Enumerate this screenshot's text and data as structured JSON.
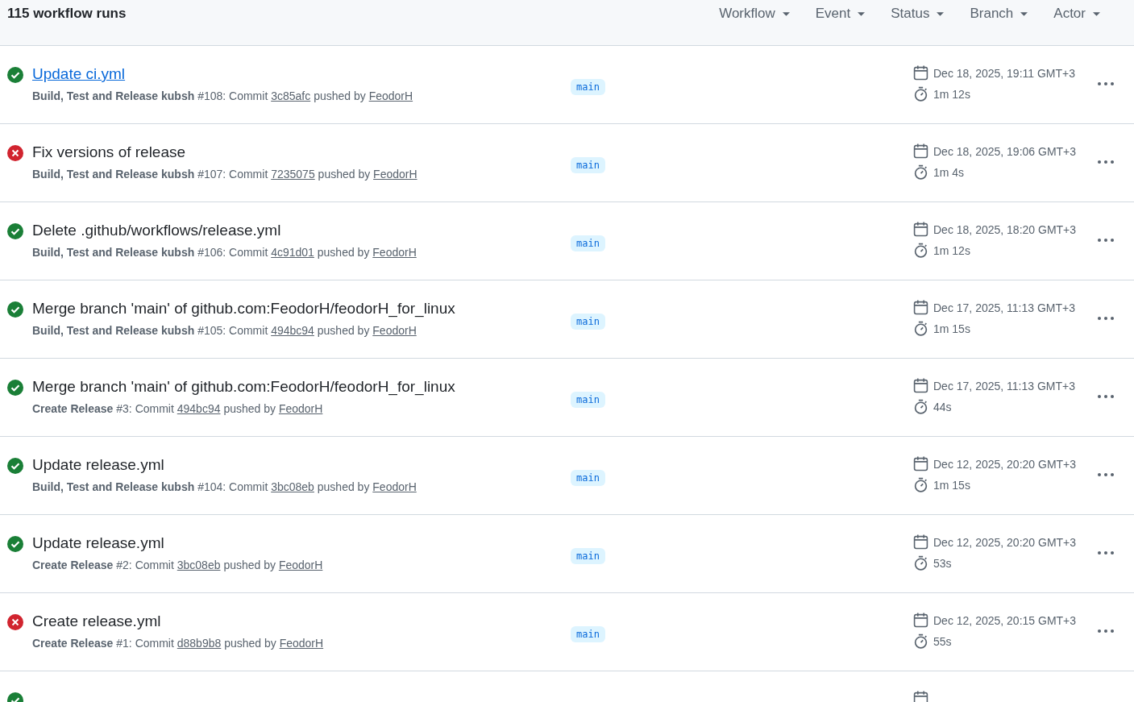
{
  "header": {
    "count": "115 workflow runs",
    "filters": [
      "Workflow",
      "Event",
      "Status",
      "Branch",
      "Actor"
    ]
  },
  "runs": [
    {
      "kind": "success",
      "title": "Update ci.yml",
      "hovered": true,
      "workflow": "Build, Test and Release kubsh",
      "detail": "#108: Commit",
      "commit": "3c85afc",
      "pushed_by": "pushed by",
      "actor": "FeodorH",
      "branch": "main",
      "date": "Dec 18, 2025, 19:11 GMT+3",
      "duration": "1m 12s"
    },
    {
      "kind": "failure",
      "title": "Fix versions of release",
      "hovered": false,
      "workflow": "Build, Test and Release kubsh",
      "detail": "#107: Commit",
      "commit": "7235075",
      "pushed_by": "pushed by",
      "actor": "FeodorH",
      "branch": "main",
      "date": "Dec 18, 2025, 19:06 GMT+3",
      "duration": "1m 4s"
    },
    {
      "kind": "success",
      "title": "Delete .github/workflows/release.yml",
      "hovered": false,
      "workflow": "Build, Test and Release kubsh",
      "detail": "#106: Commit",
      "commit": "4c91d01",
      "pushed_by": "pushed by",
      "actor": "FeodorH",
      "branch": "main",
      "date": "Dec 18, 2025, 18:20 GMT+3",
      "duration": "1m 12s"
    },
    {
      "kind": "success",
      "title": "Merge branch 'main' of github.com:FeodorH/feodorH_for_linux",
      "hovered": false,
      "workflow": "Build, Test and Release kubsh",
      "detail": "#105: Commit",
      "commit": "494bc94",
      "pushed_by": "pushed by",
      "actor": "FeodorH",
      "branch": "main",
      "date": "Dec 17, 2025, 11:13 GMT+3",
      "duration": "1m 15s"
    },
    {
      "kind": "success",
      "title": "Merge branch 'main' of github.com:FeodorH/feodorH_for_linux",
      "hovered": false,
      "workflow": "Create Release",
      "detail": "#3: Commit",
      "commit": "494bc94",
      "pushed_by": "pushed by",
      "actor": "FeodorH",
      "branch": "main",
      "date": "Dec 17, 2025, 11:13 GMT+3",
      "duration": "44s"
    },
    {
      "kind": "success",
      "title": "Update release.yml",
      "hovered": false,
      "workflow": "Build, Test and Release kubsh",
      "detail": "#104: Commit",
      "commit": "3bc08eb",
      "pushed_by": "pushed by",
      "actor": "FeodorH",
      "branch": "main",
      "date": "Dec 12, 2025, 20:20 GMT+3",
      "duration": "1m 15s"
    },
    {
      "kind": "success",
      "title": "Update release.yml",
      "hovered": false,
      "workflow": "Create Release",
      "detail": "#2: Commit",
      "commit": "3bc08eb",
      "pushed_by": "pushed by",
      "actor": "FeodorH",
      "branch": "main",
      "date": "Dec 12, 2025, 20:20 GMT+3",
      "duration": "53s"
    },
    {
      "kind": "failure",
      "title": "Create release.yml",
      "hovered": false,
      "workflow": "Create Release",
      "detail": "#1: Commit",
      "commit": "d88b9b8",
      "pushed_by": "pushed by",
      "actor": "FeodorH",
      "branch": "main",
      "date": "Dec 12, 2025, 20:15 GMT+3",
      "duration": "55s"
    },
    {
      "kind": "success"
    }
  ]
}
